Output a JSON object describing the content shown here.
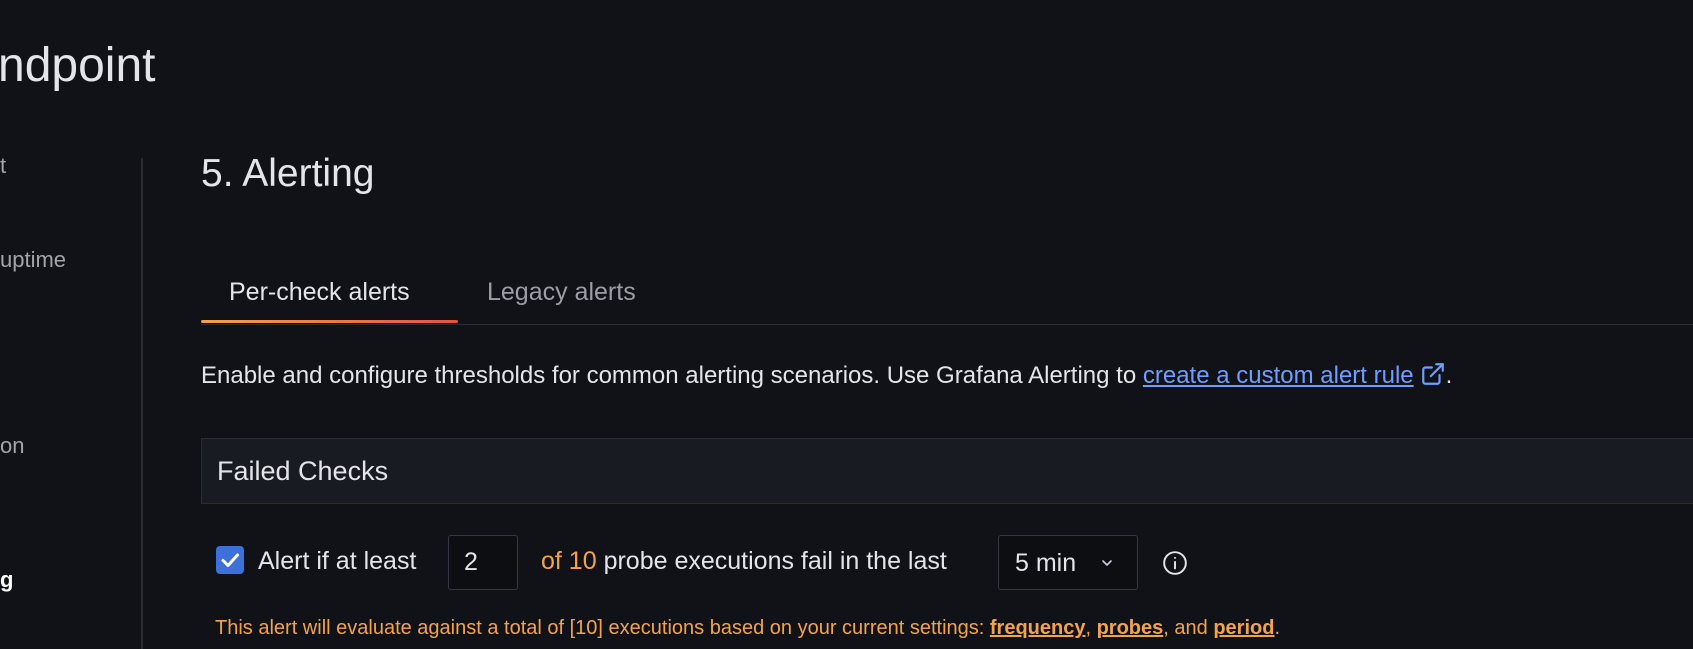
{
  "page": {
    "title": "ndpoint"
  },
  "sidebar": {
    "items": [
      {
        "label": "t"
      },
      {
        "label": "uptime"
      },
      {
        "label": "on"
      },
      {
        "label": "g"
      }
    ]
  },
  "section": {
    "title": "5. Alerting"
  },
  "tabs": [
    {
      "label": "Per-check alerts",
      "active": true
    },
    {
      "label": "Legacy alerts",
      "active": false
    }
  ],
  "description": {
    "text": "Enable and configure thresholds for common alerting scenarios. Use Grafana Alerting to ",
    "link_text": "create a custom alert rule",
    "suffix": "."
  },
  "failed_checks": {
    "title": "Failed Checks",
    "enabled": true,
    "prefix": "Alert if at least",
    "threshold_value": "2",
    "of_total": "of 10",
    "middle": "probe executions fail in the last",
    "period_value": "5 min",
    "note": {
      "text": "This alert will evaluate against a total of [10] executions based on your current settings: ",
      "link_frequency": "frequency",
      "sep1": ", ",
      "link_probes": "probes",
      "sep2": ", and ",
      "link_period": "period",
      "suffix": "."
    }
  },
  "icons": {
    "external_link": "external-link-icon",
    "checkmark": "check-icon",
    "chevron": "chevron-down-icon",
    "info": "info-circle-icon"
  },
  "colors": {
    "background": "#111217",
    "accent_orange": "#f3a44b",
    "link_blue": "#6e9fff",
    "checkbox_blue": "#3d71d9",
    "tab_underline": "#e5533f"
  }
}
